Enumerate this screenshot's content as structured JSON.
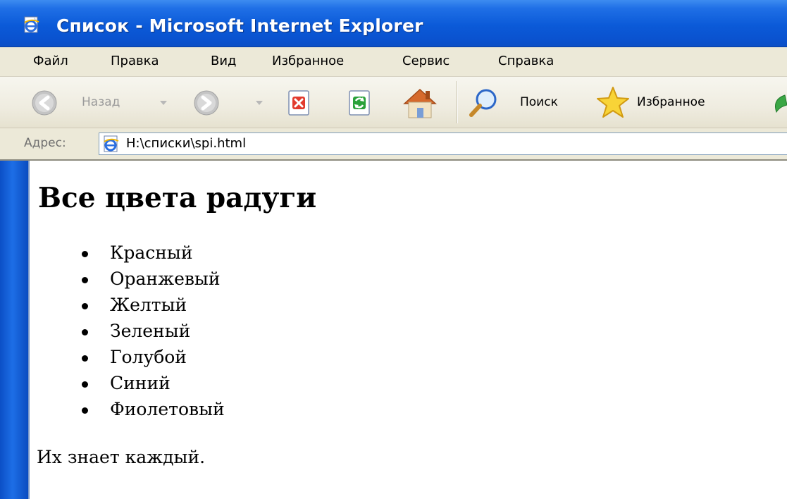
{
  "window": {
    "title": "Список - Microsoft Internet Explorer",
    "title_bar_color": "#0b5ad8",
    "icon": "ie-page-icon"
  },
  "menu": {
    "items": [
      {
        "label": "Файл"
      },
      {
        "label": "Правка"
      },
      {
        "label": "Вид"
      },
      {
        "label": "Избранное"
      },
      {
        "label": "Сервис"
      },
      {
        "label": "Справка"
      }
    ]
  },
  "toolbar": {
    "back_label": "Назад",
    "back_icon": "back-arrow-icon",
    "forward_icon": "forward-arrow-icon",
    "stop_icon": "stop-icon",
    "refresh_icon": "refresh-icon",
    "home_icon": "home-icon",
    "search_label": "Поиск",
    "search_icon": "search-icon",
    "favorites_label": "Избранное",
    "favorites_icon": "star-icon"
  },
  "address_bar": {
    "label": "Адрес:",
    "url": "H:\\списки\\spi.html",
    "icon": "ie-page-icon"
  },
  "page": {
    "heading": "Все цвета радуги",
    "list": [
      "Красный",
      "Оранжевый",
      "Желтый",
      "Зеленый",
      "Голубой",
      "Синий",
      "Фиолетовый"
    ],
    "footer": "Их знает каждый."
  }
}
